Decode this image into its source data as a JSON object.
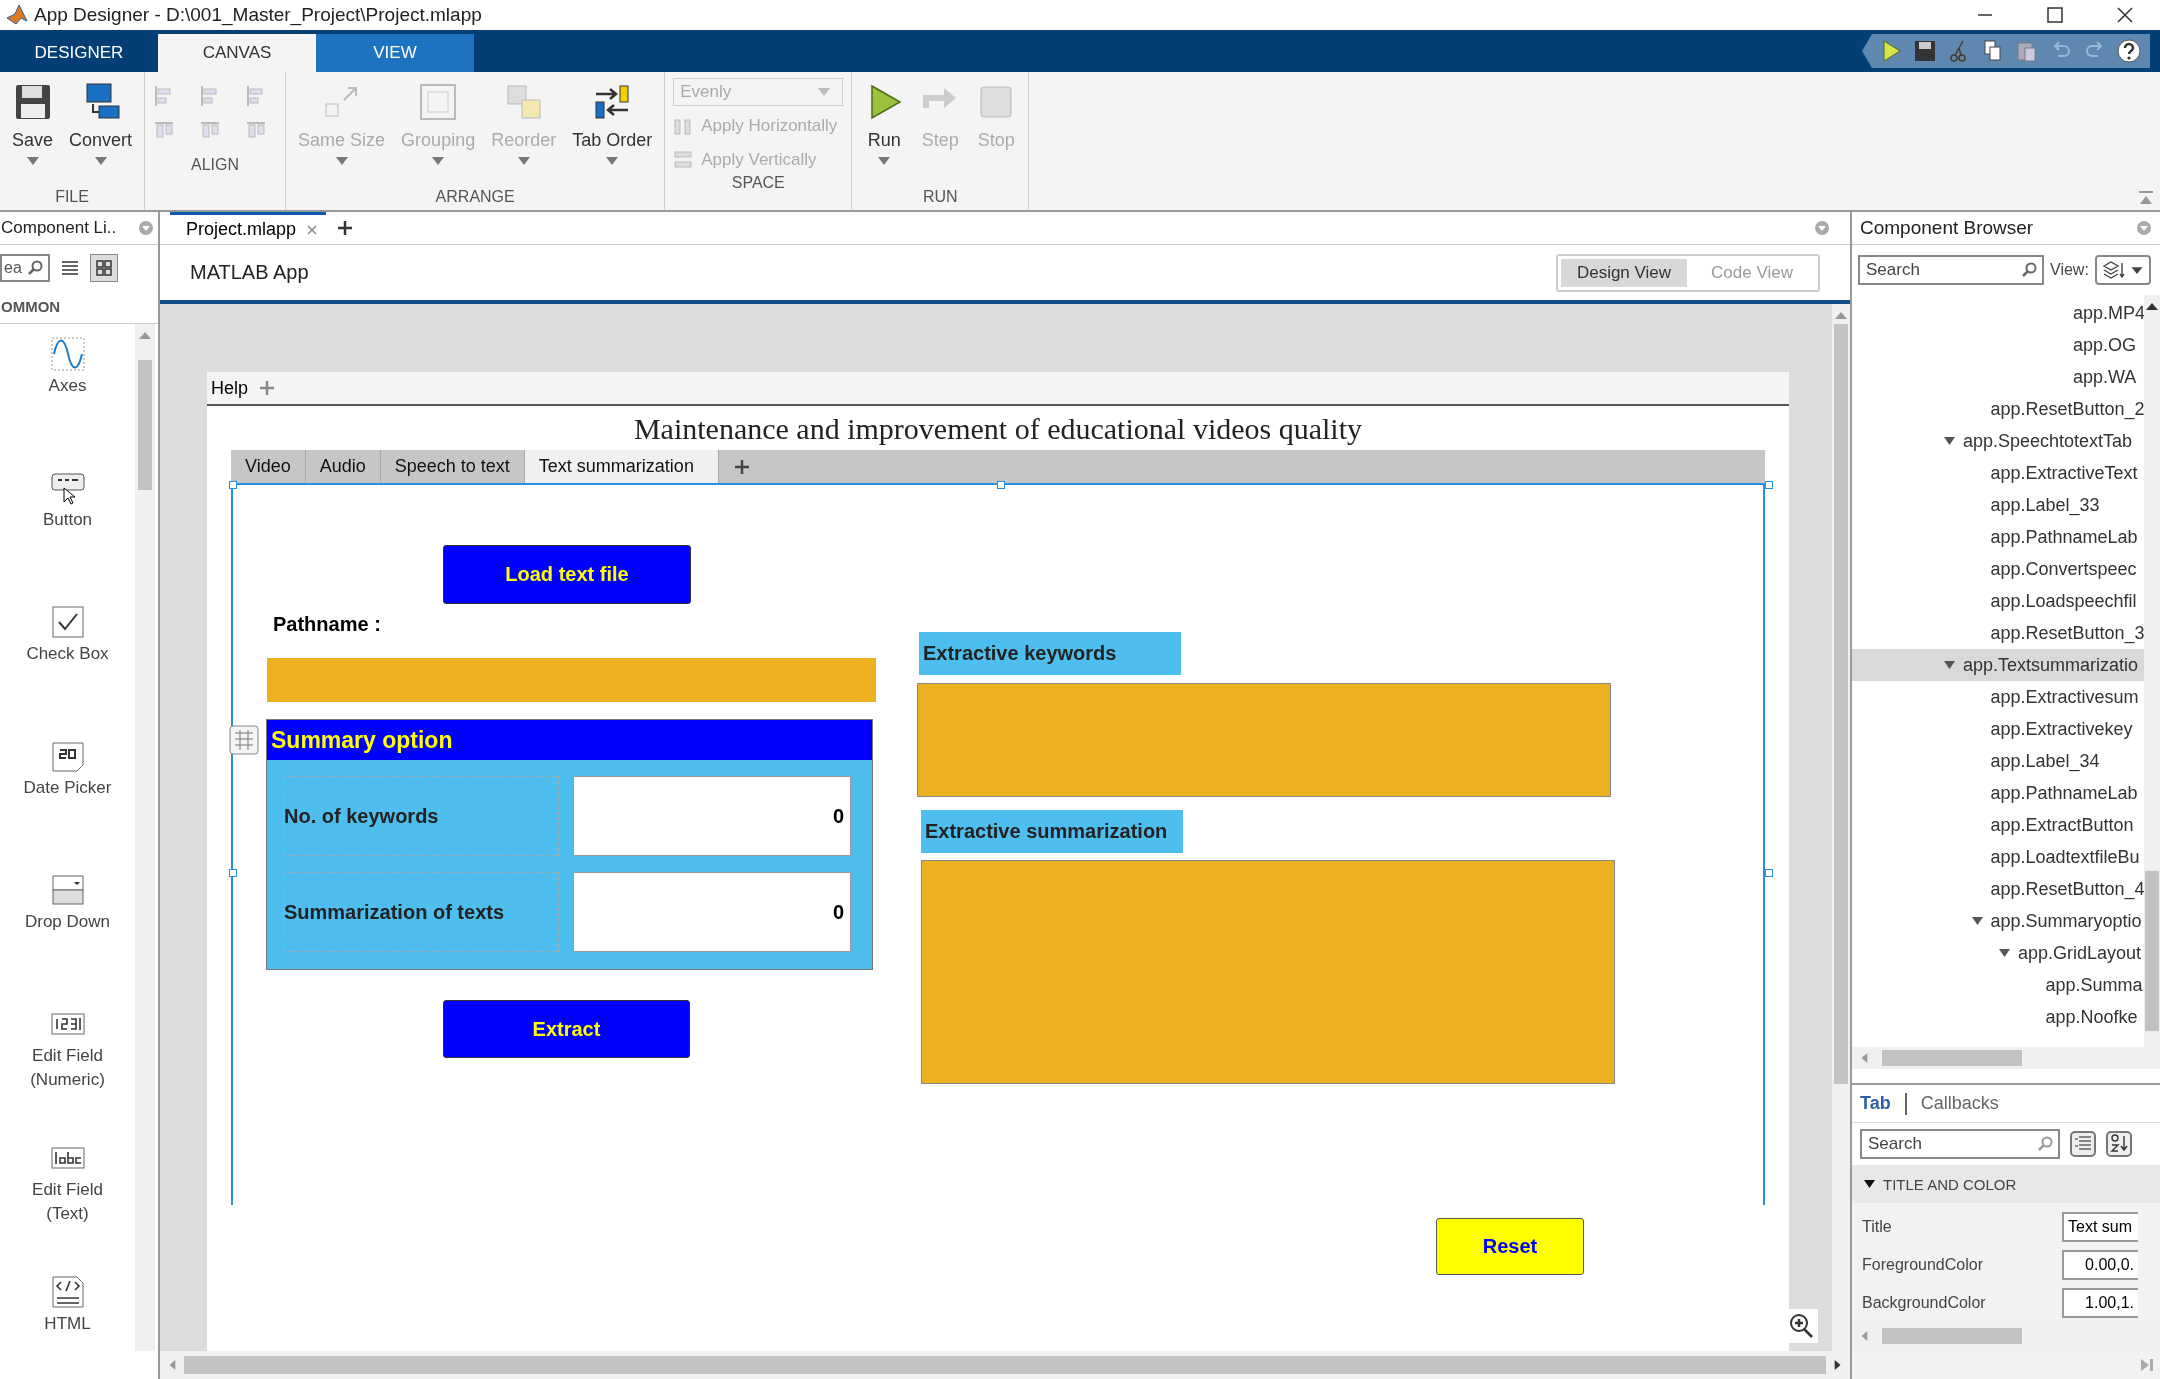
{
  "window": {
    "title": "App Designer - D:\\001_Master_Project\\Project.mlapp"
  },
  "ribbon": {
    "tabs": [
      {
        "label": "DESIGNER",
        "selected": false,
        "kind": "standard"
      },
      {
        "label": "CANVAS",
        "selected": true,
        "kind": "standard"
      },
      {
        "label": "VIEW",
        "selected": false,
        "kind": "contextual"
      }
    ],
    "groups": [
      {
        "title": "FILE",
        "kind": "tools",
        "tools": [
          {
            "label": "Save",
            "disabled": false,
            "menu": true
          },
          {
            "label": "Convert",
            "disabled": false,
            "menu": true
          }
        ]
      },
      {
        "title": "ALIGN",
        "kind": "align"
      },
      {
        "title": "ARRANGE",
        "kind": "tools",
        "tools": [
          {
            "label": "Same Size",
            "disabled": true,
            "menu": true
          },
          {
            "label": "Grouping",
            "disabled": true,
            "menu": true
          },
          {
            "label": "Reorder",
            "disabled": true,
            "menu": true
          },
          {
            "label": "Tab Order",
            "disabled": false,
            "menu": true
          }
        ]
      },
      {
        "title": "SPACE",
        "kind": "space",
        "dropdown": {
          "value": "Evenly",
          "disabled": true
        },
        "options": [
          {
            "label": "Apply Horizontally",
            "disabled": true
          },
          {
            "label": "Apply Vertically",
            "disabled": true
          }
        ]
      },
      {
        "title": "RUN",
        "kind": "tools",
        "tools": [
          {
            "label": "Run",
            "disabled": false,
            "menu": true
          },
          {
            "label": "Step",
            "disabled": true,
            "menu": false
          },
          {
            "label": "Stop",
            "disabled": true,
            "menu": false
          }
        ]
      }
    ]
  },
  "component_library": {
    "title": "Component Li..",
    "search": {
      "placeholder": "ea"
    },
    "section": "OMMON",
    "items": [
      {
        "label": "Axes",
        "kind": "axes"
      },
      {
        "label": "Button",
        "kind": "button"
      },
      {
        "label": "Check Box",
        "kind": "checkbox"
      },
      {
        "label": "Date Picker",
        "kind": "date"
      },
      {
        "label": "Drop Down",
        "kind": "dropdown"
      },
      {
        "label": "Edit Field (Numeric)",
        "kind": "numeric"
      },
      {
        "label": "Edit Field (Text)",
        "kind": "text"
      },
      {
        "label": "HTML",
        "kind": "html"
      }
    ]
  },
  "editor": {
    "doc_tabs": [
      {
        "label": "Project.mlapp",
        "selected": true
      }
    ],
    "app_name": "MATLAB App",
    "views": [
      {
        "label": "Design View",
        "selected": true
      },
      {
        "label": "Code View",
        "selected": false
      }
    ],
    "app": {
      "menu": [
        "Help"
      ],
      "heading": "Maintenance and improvement of educational videos quality",
      "tabs": [
        {
          "label": "Video",
          "selected": false
        },
        {
          "label": "Audio",
          "selected": false
        },
        {
          "label": "Speech to text",
          "selected": false
        },
        {
          "label": "Text summarization",
          "selected": true
        }
      ],
      "load_button": "Load text file",
      "pathname_label": "Pathname :",
      "summary_panel": {
        "title": "Summary option",
        "rows": [
          {
            "label": "No. of keywords",
            "value": "0"
          },
          {
            "label": "Summarization of texts",
            "value": "0"
          }
        ]
      },
      "extract_button": "Extract",
      "keywords_label": "Extractive keywords",
      "summary_label": "Extractive summarization",
      "reset_button": "Reset"
    }
  },
  "component_browser": {
    "title": "Component Browser",
    "search": {
      "placeholder": "Search"
    },
    "view_label": "View:",
    "tree": [
      {
        "children": [
          {
            "children": [
              {
                "children": [
                  {
                    "children": [
                      {
                        "label": "app.MP4",
                        "selected": false
                      },
                      {
                        "label": "app.OG",
                        "selected": false
                      },
                      {
                        "label": "app.WA",
                        "selected": false
                      }
                    ]
                  }
                ]
              }
            ]
          },
          {
            "label": "app.ResetButton_2",
            "selected": false
          }
        ]
      },
      {
        "label": "app.SpeechtotextTab",
        "selected": false,
        "expanded": true,
        "children": [
          {
            "label": "app.ExtractiveText",
            "selected": false
          },
          {
            "label": "app.Label_33",
            "selected": false
          },
          {
            "label": "app.PathnameLab",
            "selected": false
          },
          {
            "label": "app.Convertspeec",
            "selected": false
          },
          {
            "label": "app.Loadspeechfil",
            "selected": false
          },
          {
            "label": "app.ResetButton_3",
            "selected": false
          }
        ]
      },
      {
        "label": "app.Textsummarizatio",
        "selected": true,
        "expanded": true,
        "children": [
          {
            "label": "app.Extractivesum",
            "selected": false
          },
          {
            "label": "app.Extractivekey",
            "selected": false
          },
          {
            "label": "app.Label_34",
            "selected": false
          },
          {
            "label": "app.PathnameLab",
            "selected": false
          },
          {
            "label": "app.ExtractButton",
            "selected": false
          },
          {
            "label": "app.LoadtextfileBu",
            "selected": false
          },
          {
            "label": "app.ResetButton_4",
            "selected": false
          },
          {
            "label": "app.Summaryoptio",
            "selected": false,
            "expanded": true,
            "children": [
              {
                "label": "app.GridLayout",
                "selected": false,
                "expanded": true,
                "children": [
                  {
                    "label": "app.Summa",
                    "selected": false
                  },
                  {
                    "label": "app.Noofke",
                    "selected": false
                  }
                ]
              }
            ]
          }
        ]
      }
    ]
  },
  "inspector": {
    "tabs": [
      {
        "label": "Tab",
        "selected": true
      },
      {
        "label": "Callbacks",
        "selected": false
      }
    ],
    "search": {
      "placeholder": "Search"
    },
    "section": {
      "title": "TITLE AND COLOR",
      "expanded": true
    },
    "properties": [
      {
        "name": "Title",
        "value": "Text sum",
        "kind": "text"
      },
      {
        "name": "ForegroundColor",
        "value": "0.00,0.",
        "kind": "numeric"
      },
      {
        "name": "BackgroundColor",
        "value": "1.00,1.",
        "kind": "numeric"
      }
    ]
  }
}
